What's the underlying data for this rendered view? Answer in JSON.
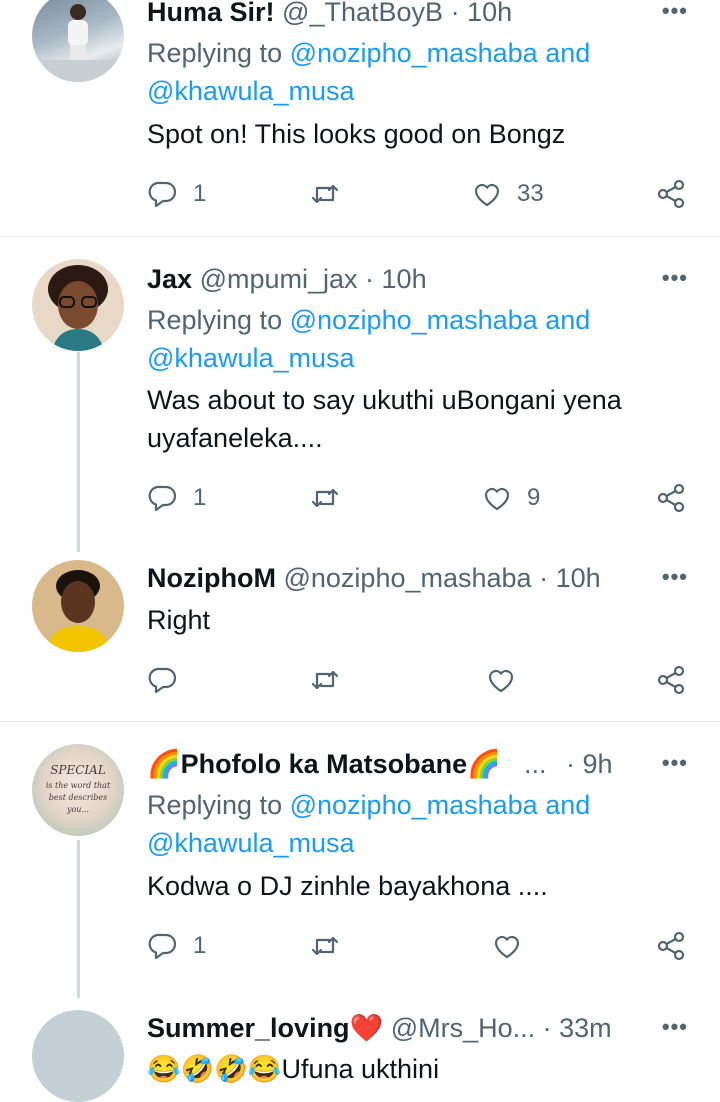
{
  "tweets": [
    {
      "name": "Huma Sir!",
      "handle": "@_ThatBoyB",
      "time": "· 10h",
      "replying_label": "Replying to",
      "mention1": "@nozipho_mashaba",
      "and": "and",
      "mention2": "@khawula_musa",
      "body": [
        "Spot on! This looks good on Bongz"
      ],
      "replies": "1",
      "retweets": "",
      "likes": "33"
    },
    {
      "name": "Jax",
      "handle": "@mpumi_jax",
      "time": "· 10h",
      "replying_label": "Replying to",
      "mention1": "@nozipho_mashaba",
      "and": "and",
      "mention2": "@khawula_musa",
      "body": [
        "Was about to say ukuthi uBongani yena",
        "uyafaneleka...."
      ],
      "replies": "1",
      "retweets": "",
      "likes": "9"
    },
    {
      "name": "NoziphoM",
      "handle": "@nozipho_mashaba",
      "time": "· 10h",
      "body": [
        "Right"
      ],
      "replies": "",
      "retweets": "",
      "likes": ""
    },
    {
      "name": "🌈Phofolo ka Matsobane🌈",
      "handle": "...",
      "time": "· 9h",
      "replying_label": "Replying to",
      "mention1": "@nozipho_mashaba",
      "and": "and",
      "mention2": "@khawula_musa",
      "body": [
        "Kodwa o DJ zinhle bayakhona ...."
      ],
      "avatar_text": [
        "SPECIAL",
        "is the word that",
        "best describes",
        "you..."
      ],
      "replies": "1",
      "retweets": "",
      "likes": ""
    },
    {
      "name": "Summer_loving❤️",
      "handle": "@Mrs_Ho...",
      "time": "· 33m",
      "body": [
        "😂🤣🤣😂Ufuna ukthini"
      ]
    }
  ],
  "more_icon": "•••",
  "colors": {
    "link": "#1d9bf0",
    "muted": "#536471",
    "text": "#0f1419"
  }
}
